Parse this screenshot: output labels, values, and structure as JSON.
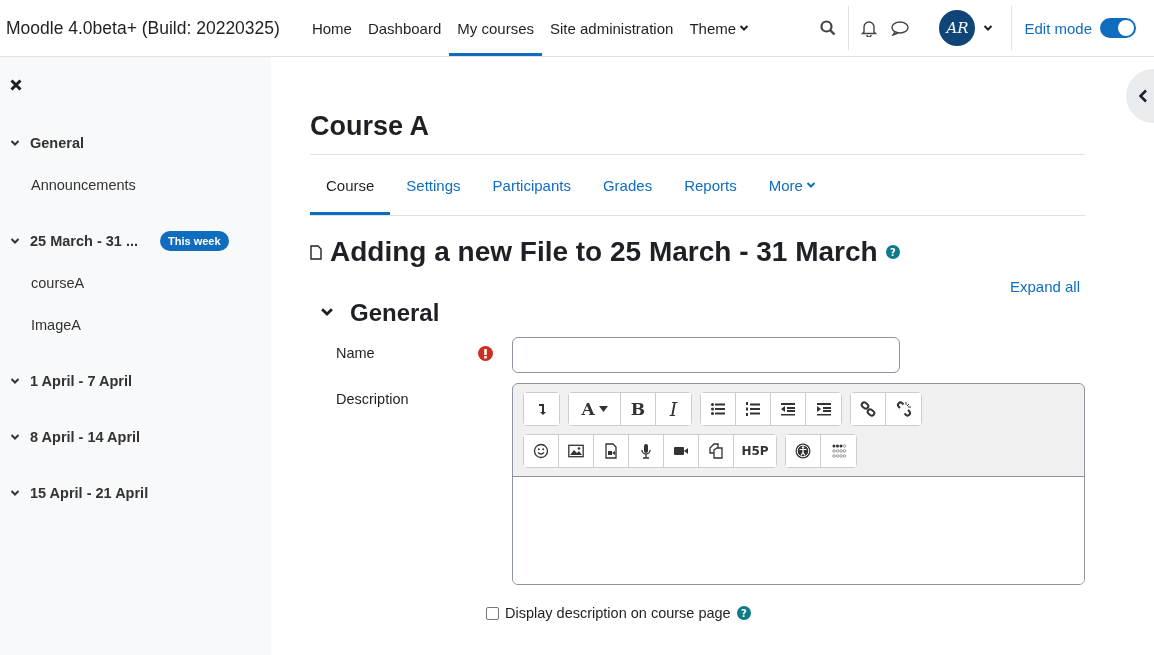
{
  "site_name": "Moodle 4.0beta+ (Build: 20220325)",
  "nav": [
    {
      "label": "Home",
      "selected": false,
      "dropdown": false
    },
    {
      "label": "Dashboard",
      "selected": false,
      "dropdown": false
    },
    {
      "label": "My courses",
      "selected": true,
      "dropdown": false
    },
    {
      "label": "Site administration",
      "selected": false,
      "dropdown": false
    },
    {
      "label": "Theme",
      "selected": false,
      "dropdown": true
    }
  ],
  "user": {
    "initials": "AR"
  },
  "edit_mode": {
    "label": "Edit mode",
    "on": true
  },
  "sidebar": {
    "sections": [
      {
        "title": "General",
        "expanded": true,
        "children": [
          {
            "label": "Announcements"
          }
        ]
      },
      {
        "title": "25 March - 31 ...",
        "expanded": true,
        "badge": "This week",
        "children": [
          {
            "label": "courseA"
          },
          {
            "label": "ImageA"
          }
        ]
      },
      {
        "title": "1 April - 7 April",
        "expanded": true
      },
      {
        "title": "8 April - 14 April",
        "expanded": true
      },
      {
        "title": "15 April - 21 April",
        "expanded": true
      }
    ]
  },
  "course_title": "Course A",
  "tabs": [
    {
      "label": "Course",
      "selected": true,
      "dropdown": false
    },
    {
      "label": "Settings",
      "selected": false,
      "dropdown": false
    },
    {
      "label": "Participants",
      "selected": false,
      "dropdown": false
    },
    {
      "label": "Grades",
      "selected": false,
      "dropdown": false
    },
    {
      "label": "Reports",
      "selected": false,
      "dropdown": false
    },
    {
      "label": "More",
      "selected": false,
      "dropdown": true
    }
  ],
  "page_heading": "Adding a new File to 25 March - 31 March",
  "page_heading_help": "?",
  "expand_all": "Expand all",
  "section": {
    "title": "General",
    "expanded": true
  },
  "fields": [
    {
      "label": "Name",
      "required": true,
      "kind": "text"
    },
    {
      "label": "Description",
      "required": false,
      "kind": "editor"
    }
  ],
  "toolbar": [
    [
      [
        {
          "kind": "collapse"
        }
      ],
      [
        {
          "kind": "font",
          "label": "A"
        },
        {
          "kind": "bold",
          "label": "B"
        },
        {
          "kind": "italic",
          "label": "I"
        }
      ],
      [
        {
          "kind": "ul"
        },
        {
          "kind": "ol"
        },
        {
          "kind": "outdent"
        },
        {
          "kind": "indent"
        }
      ],
      [
        {
          "kind": "link"
        },
        {
          "kind": "unlink"
        }
      ]
    ],
    [
      [
        {
          "kind": "emoji"
        },
        {
          "kind": "image"
        },
        {
          "kind": "media"
        },
        {
          "kind": "mic"
        },
        {
          "kind": "video"
        },
        {
          "kind": "copy"
        },
        {
          "kind": "h5p",
          "label": "H5P"
        }
      ],
      [
        {
          "kind": "accessibility"
        },
        {
          "kind": "braille"
        }
      ]
    ]
  ],
  "display_description": {
    "label": "Display description on course page",
    "checked": false,
    "help": "?"
  }
}
